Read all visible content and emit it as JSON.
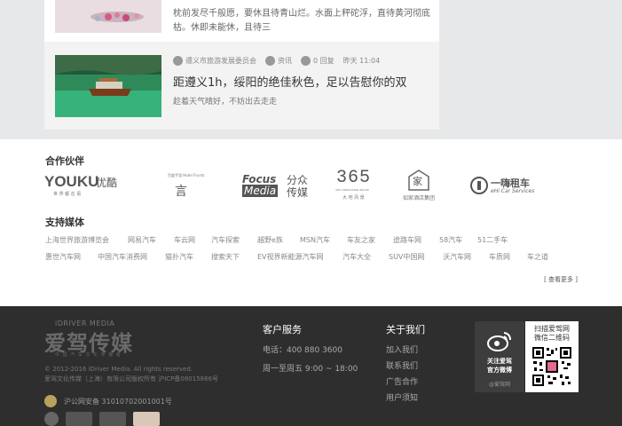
{
  "articles": [
    {
      "excerpt": "枕前发尽千般愿，要休且待青山烂。水面上秤砣浮，直待黄河彻底枯。休即未能休，且待三"
    },
    {
      "source": "遵义市旅游发展委员会",
      "category": "资讯",
      "comments": "0 回复",
      "time": "昨天 11:04",
      "title": "距遵义1h，绥阳的绝佳秋色，足以告慰你的双",
      "subtitle": "趁着天气晴好，不妨出去走走"
    }
  ],
  "partners": {
    "title": "合作伙伴",
    "logos": [
      {
        "icon": "youku-logo",
        "name": "YOUKU",
        "cn": "优酷",
        "tagline": "世 界 都 在 看"
      },
      {
        "icon": "hotel-seal-logo",
        "small": "百度手游 Hotel Frunts",
        "glyph": "言"
      },
      {
        "icon": "focus-media-logo",
        "en1": "Focus",
        "en2": "Media",
        "cn": "分众传媒"
      },
      {
        "icon": "365-consulting-logo",
        "name": "365",
        "sub": "365 CONSULTING GROUP",
        "cn": "大 地 风 景"
      },
      {
        "icon": "rujia-logo",
        "glyph": "家",
        "cn": "如家酒店集团"
      },
      {
        "icon": "ehi-logo",
        "cn": "一嗨租车",
        "en": "eHi Car Services"
      }
    ]
  },
  "media": {
    "title": "支持媒体",
    "row1": [
      "上海世界旅游博览会",
      "网易汽车",
      "车云网",
      "汽车探索",
      "越野e族",
      "MSN汽车",
      "车友之家",
      "途路车网",
      "58汽车",
      "51二手车"
    ],
    "row2": [
      "惠世汽车网",
      "中国汽车消费网",
      "猫扑汽车",
      "搜索天下",
      "EV视界新能源汽车网",
      "汽车大全",
      "SUV中国网",
      "沃汽车网",
      "车质网",
      "车之道"
    ],
    "more": "[ 查看更多 ]"
  },
  "footer": {
    "brand_en": "iDRIVER MEDIA",
    "brand_cn": "爱驾传媒",
    "brand_slogan": "中 国 汽 车 文 化 传 播 者",
    "copyright_1": "© 2012-2016 iDriver Media. All rights reserved.",
    "copyright_2": "爱驾文化传媒（上海）有限公司版权所有 沪ICP备08015866号",
    "police": "沪公网安备 31010702001001号",
    "service_title": "客户服务",
    "phone": "电话：400 880 3600",
    "hours": "周一至周五 9:00 ~ 18:00",
    "about_title": "关于我们",
    "about_links": [
      "加入我们",
      "联系我们",
      "广告合作",
      "用户须知"
    ],
    "weibo_text_1": "关注爱驾",
    "weibo_text_2": "官方微博",
    "weibo_handle": "@爱驾网",
    "qr_title_1": "扫描爱驾网",
    "qr_title_2": "微信二维码"
  }
}
